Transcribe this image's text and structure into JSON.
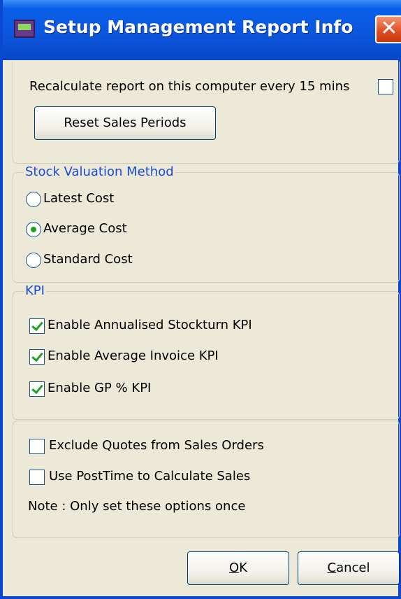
{
  "window": {
    "title": "Setup Management Report Info",
    "close_glyph": "✕",
    "icon": "app-icon"
  },
  "general": {
    "recalc_label": "Recalculate report on this computer every 15 mins",
    "recalc_checked": false,
    "reset_button": "Reset Sales Periods"
  },
  "stock_valuation": {
    "legend": "Stock Valuation Method",
    "options": [
      {
        "label": "Latest Cost",
        "selected": false
      },
      {
        "label": "Average Cost",
        "selected": true
      },
      {
        "label": "Standard Cost",
        "selected": false
      }
    ]
  },
  "kpi": {
    "legend": "KPI",
    "options": [
      {
        "label": "Enable Annualised Stockturn KPI",
        "checked": true
      },
      {
        "label": "Enable Average Invoice KPI",
        "checked": true
      },
      {
        "label": "Enable GP % KPI",
        "checked": true
      }
    ]
  },
  "sales_options": {
    "options": [
      {
        "label": "Exclude Quotes from Sales Orders",
        "checked": false
      },
      {
        "label": "Use PostTime to Calculate Sales",
        "checked": false
      }
    ],
    "note": "Note : Only set these options once"
  },
  "buttons": {
    "ok": {
      "text": "OK",
      "mnemonic": "O"
    },
    "cancel": {
      "text": "Cancel",
      "mnemonic": "C"
    }
  },
  "colors": {
    "titlebar": "#0a5fe8",
    "group_label": "#1b4bd6",
    "check": "#21a121",
    "close": "#df4b20"
  }
}
